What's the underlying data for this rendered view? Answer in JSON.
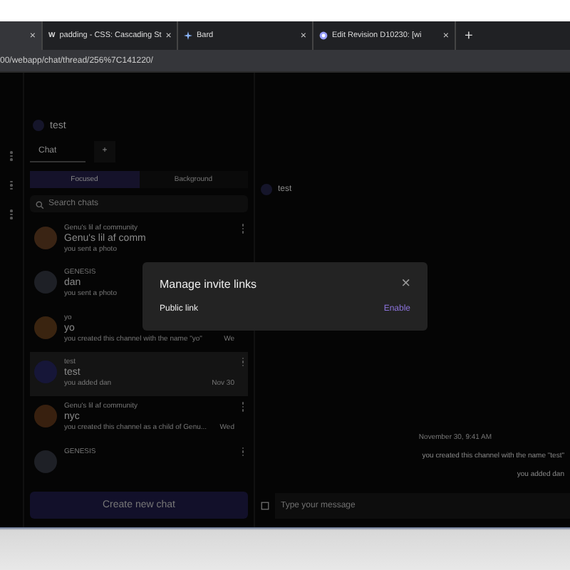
{
  "browser": {
    "tabs": [
      {
        "selected": true,
        "close": "×"
      },
      {
        "favicon": "W",
        "title": "padding - CSS: Cascading St",
        "selected": false,
        "close": "×"
      },
      {
        "title": "Bard",
        "selected": false,
        "close": "×"
      },
      {
        "title": "Edit Revision D10230: [wi",
        "selected": false,
        "close": "×"
      }
    ],
    "new_tab": "+",
    "address": "00/webapp/chat/thread/256%7C141220/"
  },
  "sidebar": {
    "workspace": "test",
    "tabs": [
      {
        "label": "Chat",
        "selected": true
      },
      {
        "label": "+",
        "selected": false
      }
    ],
    "filters": [
      {
        "label": "Focused",
        "selected": true
      },
      {
        "label": "Background",
        "selected": false
      }
    ],
    "search": {
      "placeholder": "Search chats"
    },
    "chats": [
      {
        "group": "Genu's lil af community",
        "name": "Genu's lil af comm",
        "preview": "you sent a photo",
        "color": "#3a2414",
        "selected": false
      },
      {
        "group": "GENESIS",
        "name": "dan",
        "preview": "you sent a photo",
        "color": "#1e2026",
        "selected": false
      },
      {
        "group": "yo",
        "name": "yo",
        "preview": "you created this channel with the name \"yo\"",
        "time": "We",
        "color": "#3a2410",
        "selected": false
      },
      {
        "group": "test",
        "name": "test",
        "preview": "you added dan",
        "time": "Nov 30",
        "color": "#161638",
        "selected": true
      },
      {
        "group": "Genu's lil af community",
        "name": "nyc",
        "preview": "you created this channel as a child of Genu...",
        "time": "Wed",
        "color": "#38200f",
        "selected": false
      },
      {
        "group": "GENESIS",
        "color": "#1e2026",
        "selected": false
      }
    ],
    "create_button": "Create new chat"
  },
  "thread": {
    "title": "test",
    "date": "November 30, 9:41 AM",
    "events": [
      "you created this channel with the name \"test\"",
      "you added dan"
    ],
    "composer": {
      "placeholder": "Type your message"
    }
  },
  "modal": {
    "title": "Manage invite links",
    "close": "×",
    "rows": [
      {
        "label": "Public link",
        "action": "Enable"
      }
    ]
  }
}
